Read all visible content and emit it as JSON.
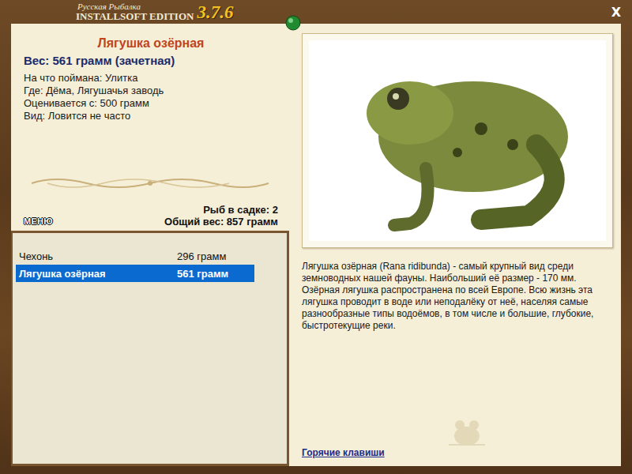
{
  "window": {
    "title_top": "Русская Рыбалка",
    "title_bottom": "INSTALLSOFT EDITION",
    "version": "3.7.6",
    "close": "X"
  },
  "fish": {
    "name": "Лягушка озёрная",
    "weight": "Вес: 561 грамм (зачетная)",
    "details": [
      "На что поймана: Улитка",
      "Где: Дёма, Лягушачья заводь",
      "Оценивается с: 500 грамм",
      "Вид: Ловится не часто"
    ]
  },
  "keepnet": {
    "count": "Рыб в садке: 2",
    "total": "Общий вес: 857 грамм"
  },
  "menu_button": "МЕНЮ",
  "catch_list": [
    {
      "name": "Чехонь",
      "weight": "296 грамм",
      "selected": false
    },
    {
      "name": "Лягушка озёрная",
      "weight": "561 грамм",
      "selected": true
    }
  ],
  "description": "Лягушка озёрная (Rana ridibunda) - самый крупный вид среди земноводных нашей фауны. Наибольший её размер - 170 мм. Озёрная лягушка распространена по всей Европе. Всю жизнь эта лягушка проводит в воде или неподалёку от неё, населяя самые разнообразные типы водоёмов, в том числе и большие, глубокие, быстротекущие реки.",
  "hotkeys_link": "Горячие клавиши"
}
